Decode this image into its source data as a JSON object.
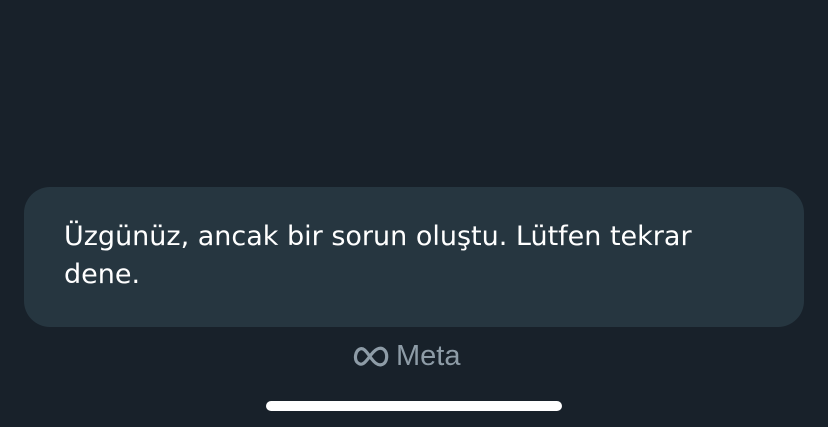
{
  "toast": {
    "message": "Üzgünüz, ancak bir sorun oluştu. Lütfen tekrar dene."
  },
  "branding": {
    "logo_icon": "meta-infinity-icon",
    "text": "Meta"
  },
  "system": {
    "home_indicator": "home-indicator"
  },
  "colors": {
    "background": "#18212a",
    "toast_background": "#263640",
    "toast_text": "#ffffff",
    "brand_text": "#8e9ca7",
    "home_indicator": "#ffffff"
  }
}
